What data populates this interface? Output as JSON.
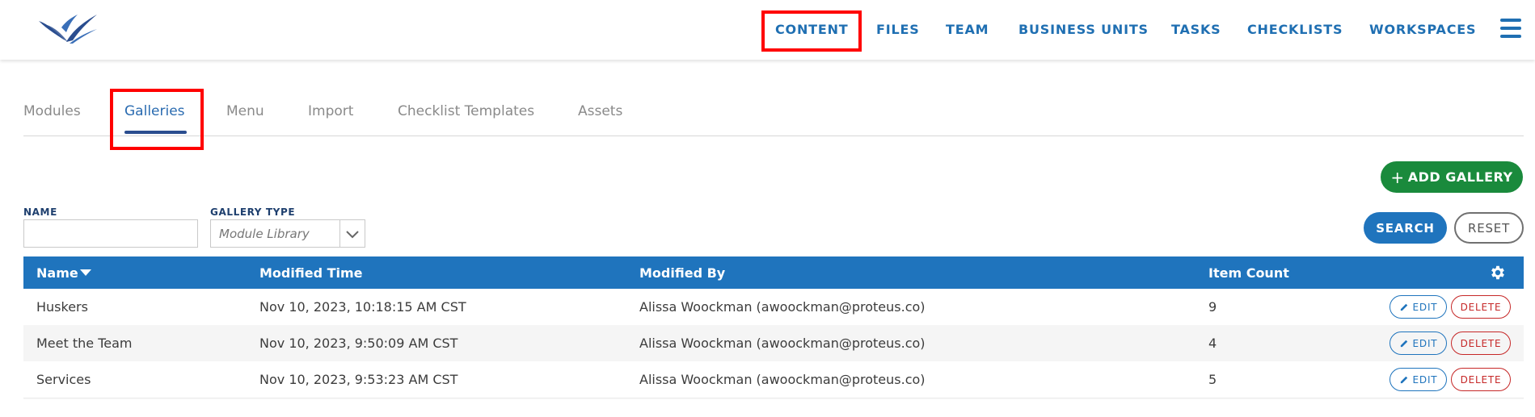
{
  "brand": {
    "logo_icon": "bird-swoosh-logo-icon",
    "logo_color": "#2a4d8f"
  },
  "top_nav": {
    "items": [
      {
        "label": "CONTENT",
        "highlighted": true
      },
      {
        "label": "FILES"
      },
      {
        "label": "TEAM"
      },
      {
        "label": "BUSINESS UNITS"
      },
      {
        "label": "TASKS"
      },
      {
        "label": "CHECKLISTS"
      },
      {
        "label": "WORKSPACES"
      }
    ],
    "menu_icon": "hamburger-menu-icon",
    "color": "#1f6fb2"
  },
  "tabs": {
    "items": [
      {
        "label": "Modules"
      },
      {
        "label": "Galleries",
        "active": true,
        "highlighted": true
      },
      {
        "label": "Menu"
      },
      {
        "label": "Import"
      },
      {
        "label": "Checklist Templates"
      },
      {
        "label": "Assets"
      }
    ]
  },
  "actions": {
    "add_gallery_label": "ADD GALLERY",
    "add_icon": "plus-icon",
    "search_label": "SEARCH",
    "reset_label": "RESET"
  },
  "filters": {
    "name_label": "NAME",
    "name_value": "",
    "gallery_type_label": "GALLERY TYPE",
    "gallery_type_value": "Module Library"
  },
  "table": {
    "columns": [
      "Name",
      "Modified Time",
      "Modified By",
      "Item Count"
    ],
    "settings_icon": "gear-icon",
    "rows": [
      {
        "name": "Huskers",
        "modified_time": "Nov 10, 2023, 10:18:15 AM CST",
        "modified_by": "Alissa Woockman (awoockman@proteus.co)",
        "item_count": "9"
      },
      {
        "name": "Meet the Team",
        "modified_time": "Nov 10, 2023, 9:50:09 AM CST",
        "modified_by": "Alissa Woockman (awoockman@proteus.co)",
        "item_count": "4"
      },
      {
        "name": "Services",
        "modified_time": "Nov 10, 2023, 9:53:23 AM CST",
        "modified_by": "Alissa Woockman (awoockman@proteus.co)",
        "item_count": "5"
      }
    ],
    "edit_label": "EDIT",
    "delete_label": "DELETE",
    "header_color": "#1f74bd"
  },
  "colors": {
    "highlight": "#ff0000",
    "add_button": "#1a8a3c",
    "delete": "#c62828"
  }
}
